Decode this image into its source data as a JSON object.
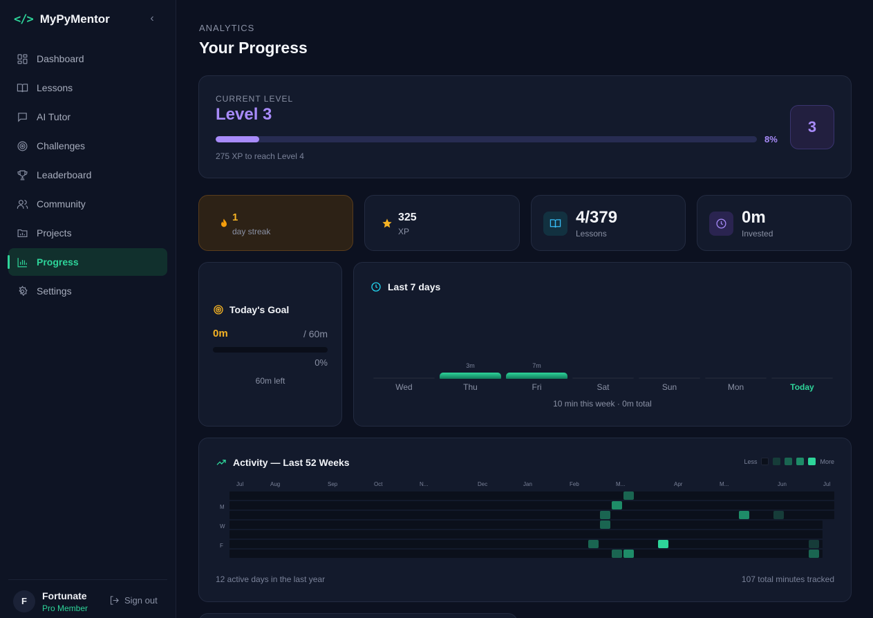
{
  "app": {
    "logo": "</>",
    "name": "MyPyMentor",
    "collapse_icon": "‹"
  },
  "nav": [
    {
      "label": "Dashboard",
      "icon": "dashboard-icon",
      "active": false
    },
    {
      "label": "Lessons",
      "icon": "book-icon",
      "active": false
    },
    {
      "label": "AI Tutor",
      "icon": "chat-icon",
      "active": false
    },
    {
      "label": "Challenges",
      "icon": "target-icon",
      "active": false
    },
    {
      "label": "Leaderboard",
      "icon": "trophy-icon",
      "active": false
    },
    {
      "label": "Community",
      "icon": "users-icon",
      "active": false
    },
    {
      "label": "Projects",
      "icon": "folder-icon",
      "active": false
    },
    {
      "label": "Progress",
      "icon": "bar-chart-icon",
      "active": true
    },
    {
      "label": "Settings",
      "icon": "gear-icon",
      "active": false
    }
  ],
  "user": {
    "initial": "F",
    "name": "Fortunate",
    "role": "Pro Member",
    "signout_label": "Sign out"
  },
  "page": {
    "eyebrow": "ANALYTICS",
    "title": "Your Progress"
  },
  "level": {
    "label": "CURRENT LEVEL",
    "title": "Level 3",
    "percent_label": "8%",
    "progress": 0.08,
    "subtext": "275 XP to reach Level 4",
    "badge": "3"
  },
  "stats": {
    "streak": {
      "value": "1",
      "label": "day streak",
      "icon": "flame-icon"
    },
    "xp": {
      "value": "325",
      "label": "XP",
      "icon": "star-icon"
    },
    "lessons": {
      "value": "4/379",
      "label": "Lessons",
      "icon": "open-book-icon"
    },
    "time": {
      "value": "0m",
      "label": "Invested",
      "icon": "clock-icon"
    }
  },
  "goal": {
    "title": "Today's Goal",
    "done": "0m",
    "total": "/ 60m",
    "percent_label": "0%",
    "progress": 0,
    "left": "60m left"
  },
  "week": {
    "title": "Last 7 days",
    "days": [
      {
        "label": "Wed",
        "amount": "",
        "minutes": 0,
        "today": false
      },
      {
        "label": "Thu",
        "amount": "3m",
        "minutes": 3,
        "today": false
      },
      {
        "label": "Fri",
        "amount": "7m",
        "minutes": 7,
        "today": false
      },
      {
        "label": "Sat",
        "amount": "",
        "minutes": 0,
        "today": false
      },
      {
        "label": "Sun",
        "amount": "",
        "minutes": 0,
        "today": false
      },
      {
        "label": "Mon",
        "amount": "",
        "minutes": 0,
        "today": false
      },
      {
        "label": "Today",
        "amount": "",
        "minutes": 0,
        "today": true
      }
    ],
    "summary": "10 min this week · 0m total"
  },
  "activity": {
    "title": "Activity — Last 52 Weeks",
    "legend_less": "Less",
    "legend_more": "More",
    "legend_colors": [
      "#0b101b",
      "#163c39",
      "#1a6551",
      "#1e8c68",
      "#2ed59a"
    ],
    "months": [
      "Jul",
      "Aug",
      "Sep",
      "Oct",
      "N...",
      "Dec",
      "Jan",
      "Feb",
      "M...",
      "Apr",
      "M...",
      "Jun",
      "Jul"
    ],
    "weekdays": [
      "M",
      "W",
      "F"
    ],
    "active_cells": [
      {
        "week": 34,
        "day": 0,
        "level": 2
      },
      {
        "week": 33,
        "day": 1,
        "level": 3
      },
      {
        "week": 32,
        "day": 2,
        "level": 2
      },
      {
        "week": 44,
        "day": 2,
        "level": 3
      },
      {
        "week": 47,
        "day": 2,
        "level": 1
      },
      {
        "week": 32,
        "day": 3,
        "level": 2
      },
      {
        "week": 31,
        "day": 5,
        "level": 2
      },
      {
        "week": 37,
        "day": 5,
        "level": 4
      },
      {
        "week": 50,
        "day": 5,
        "level": 1
      },
      {
        "week": 33,
        "day": 6,
        "level": 2
      },
      {
        "week": 34,
        "day": 6,
        "level": 3
      },
      {
        "week": 50,
        "day": 6,
        "level": 2
      }
    ],
    "footer_left": "12 active days in the last year",
    "footer_right": "107 total minutes tracked"
  }
}
